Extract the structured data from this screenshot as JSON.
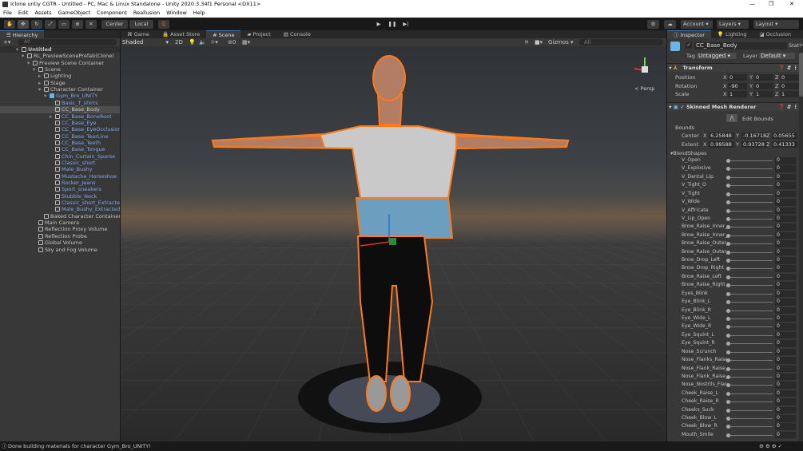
{
  "window": {
    "title": "Iclone untiy CGTR - Untitled - PC, Mac & Linux Standalone - Unity 2020.3.34f1 Personal <DX11>"
  },
  "menu": [
    "File",
    "Edit",
    "Assets",
    "GameObject",
    "Component",
    "Reallusion",
    "Window",
    "Help"
  ],
  "toolbar": {
    "center": "Center",
    "local": "Local",
    "account": "Account",
    "layers": "Layers",
    "layout": "Layout"
  },
  "hierarchy": {
    "title": "Hierarchy",
    "search_placeholder": "All",
    "items": [
      {
        "label": "Untitled",
        "depth": 0,
        "bold": true
      },
      {
        "label": "RL_PreviewScenePrefab(Clone)",
        "depth": 1
      },
      {
        "label": "Preview Scene Container",
        "depth": 2
      },
      {
        "label": "Scene",
        "depth": 3
      },
      {
        "label": "Lighting",
        "depth": 4
      },
      {
        "label": "Stage",
        "depth": 4
      },
      {
        "label": "Character Container",
        "depth": 4
      },
      {
        "label": "Gym_Bro_UNITY",
        "depth": 5,
        "prefab": true
      },
      {
        "label": "Basic_T_shirts",
        "depth": 6,
        "prefab": true
      },
      {
        "label": "CC_Base_Body",
        "depth": 6,
        "selected": true
      },
      {
        "label": "CC_Base_BoneRoot",
        "depth": 6,
        "prefab": true
      },
      {
        "label": "CC_Base_Eye",
        "depth": 6,
        "prefab": true
      },
      {
        "label": "CC_Base_EyeOcclusion",
        "depth": 6,
        "prefab": true
      },
      {
        "label": "CC_Base_TearLine",
        "depth": 6,
        "prefab": true
      },
      {
        "label": "CC_Base_Teeth",
        "depth": 6,
        "prefab": true
      },
      {
        "label": "CC_Base_Tongue",
        "depth": 6,
        "prefab": true
      },
      {
        "label": "Chin_Curtain_Sparse",
        "depth": 6,
        "prefab": true
      },
      {
        "label": "Classic_short",
        "depth": 6,
        "prefab": true
      },
      {
        "label": "Male_Bushy",
        "depth": 6,
        "prefab": true
      },
      {
        "label": "Mustache_Horseshoe",
        "depth": 6,
        "prefab": true
      },
      {
        "label": "Rocker_Jeans",
        "depth": 6,
        "prefab": true
      },
      {
        "label": "Sport_sneakers",
        "depth": 6,
        "prefab": true
      },
      {
        "label": "Stubble_Neck",
        "depth": 6,
        "prefab": true
      },
      {
        "label": "Classic_short_Extracted0",
        "depth": 6,
        "prefab": true
      },
      {
        "label": "Male_Bushy_Extracted0",
        "depth": 6,
        "prefab": true
      },
      {
        "label": "Baked Character Container",
        "depth": 4
      },
      {
        "label": "Main Camera",
        "depth": 3
      },
      {
        "label": "Reflection Proxy Volume",
        "depth": 3
      },
      {
        "label": "Reflection Probe",
        "depth": 3
      },
      {
        "label": "Global Volume",
        "depth": 3
      },
      {
        "label": "Sky and Fog Volume",
        "depth": 3
      }
    ]
  },
  "scene_tabs": [
    "Game",
    "Asset Store",
    "Scene",
    "Project",
    "Console"
  ],
  "scene_toolbar": {
    "shading": "Shaded",
    "mode2d": "2D",
    "hidden_count": "0",
    "gizmos": "Gizmos",
    "search_placeholder": "All",
    "persp": "< Persp"
  },
  "inspector": {
    "tabs": [
      "Inspector",
      "Lighting",
      "Occlusion"
    ],
    "object_name": "CC_Base_Body",
    "static": "Static",
    "tag_label": "Tag",
    "tag": "Untagged",
    "layer_label": "Layer",
    "layer": "Default",
    "transform": {
      "title": "Transform",
      "rows": [
        {
          "label": "Position",
          "x": "0",
          "y": "0",
          "z": "0"
        },
        {
          "label": "Rotation",
          "x": "-90",
          "y": "0",
          "z": "0"
        },
        {
          "label": "Scale",
          "x": "1",
          "y": "1",
          "z": "1"
        }
      ]
    },
    "smr": {
      "title": "Skinned Mesh Renderer",
      "edit_bounds": "Edit Bounds",
      "bounds": "Bounds",
      "center": {
        "label": "Center",
        "x": "6.25848",
        "y": "-0.16718",
        "z": "0.05655"
      },
      "extent": {
        "label": "Extent",
        "x": "0.99588",
        "y": "0.93728",
        "z": "0.41333"
      }
    },
    "blendshapes_title": "BlendShapes",
    "blendshapes": [
      [
        "V_Open",
        "0"
      ],
      [
        "V_Explosive",
        "0"
      ],
      [
        "V_Dental_Lip",
        "0"
      ],
      [
        "V_Tight_O",
        "0"
      ],
      [
        "V_Tight",
        "0"
      ],
      [
        "V_Wide",
        "0"
      ],
      [
        "V_Affricate",
        "0"
      ],
      [
        "V_Lip_Open",
        "0"
      ],
      [
        "Brow_Raise_Inner_",
        "0"
      ],
      [
        "Brow_Raise_Inner_",
        "0"
      ],
      [
        "Brow_Raise_Outer_",
        "0"
      ],
      [
        "Brow_Raise_Outer_",
        "0"
      ],
      [
        "Brow_Drop_Left",
        "0"
      ],
      [
        "Brow_Drop_Right",
        "0"
      ],
      [
        "Brow_Raise_Left",
        "0"
      ],
      [
        "Brow_Raise_Right",
        "0"
      ],
      [
        "Eyes_Blink",
        "0"
      ],
      [
        "Eye_Blink_L",
        "0"
      ],
      [
        "Eye_Blink_R",
        "0"
      ],
      [
        "Eye_Wide_L",
        "0"
      ],
      [
        "Eye_Wide_R",
        "0"
      ],
      [
        "Eye_Squint_L",
        "0"
      ],
      [
        "Eye_Squint_R",
        "0"
      ],
      [
        "Nose_Scrunch",
        "0"
      ],
      [
        "Nose_Flanks_Raise",
        "0"
      ],
      [
        "Nose_Flank_Raise_",
        "0"
      ],
      [
        "Nose_Flank_Raise_",
        "0"
      ],
      [
        "Nose_Nostrils_Flare",
        "0"
      ],
      [
        "Cheek_Raise_L",
        "0"
      ],
      [
        "Cheek_Raise_R",
        "0"
      ],
      [
        "Cheeks_Suck",
        "0"
      ],
      [
        "Cheek_Blow_L",
        "0"
      ],
      [
        "Cheek_Blow_R",
        "0"
      ],
      [
        "Mouth_Smile",
        "0"
      ]
    ]
  },
  "status": {
    "message": "Done building materials for character Gym_Bro_UNITY!"
  },
  "colors": {
    "selection_outline": "#ff7a1a",
    "prefab_text": "#7fa6e8",
    "accent": "#3a79bb"
  }
}
